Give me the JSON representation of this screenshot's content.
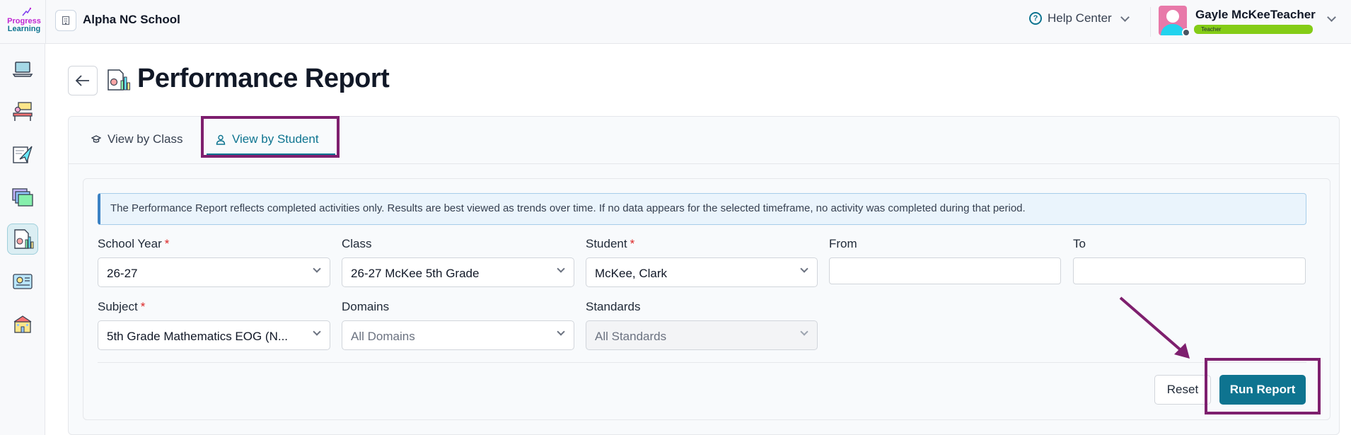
{
  "header": {
    "logo_line1": "Progress",
    "logo_line2": "Learning",
    "school_name": "Alpha NC School",
    "help_label": "Help Center",
    "user_name": "Gayle McKeeTeacher",
    "user_role": "Teacher"
  },
  "sidenav": {
    "items": [
      {
        "icon": "laptop-icon"
      },
      {
        "icon": "classroom-icon"
      },
      {
        "icon": "assignment-icon"
      },
      {
        "icon": "folders-icon"
      },
      {
        "icon": "report-icon",
        "active": true
      },
      {
        "icon": "reading-icon"
      },
      {
        "icon": "school-icon"
      }
    ]
  },
  "page": {
    "title": "Performance Report"
  },
  "tabs": [
    {
      "label": "View by Class",
      "active": false
    },
    {
      "label": "View by Student",
      "active": true
    }
  ],
  "info_text": "The Performance Report reflects completed activities only. Results are best viewed as trends over time. If no data appears for the selected timeframe, no activity was completed during that period.",
  "form": {
    "school_year": {
      "label": "School Year",
      "value": "26-27"
    },
    "class": {
      "label": "Class",
      "value": "26-27 McKee 5th Grade"
    },
    "student": {
      "label": "Student",
      "value": "McKee, Clark"
    },
    "from": {
      "label": "From",
      "value": ""
    },
    "to": {
      "label": "To",
      "value": ""
    },
    "subject": {
      "label": "Subject",
      "value": "5th Grade Mathematics EOG (N..."
    },
    "domains": {
      "label": "Domains",
      "value": "All Domains"
    },
    "standards": {
      "label": "Standards",
      "value": "All Standards"
    },
    "required_marker": "*"
  },
  "actions": {
    "reset_label": "Reset",
    "run_label": "Run Report"
  },
  "colors": {
    "accent": "#0e7490",
    "annotation": "#7e1f6e",
    "required": "#dc2626"
  }
}
